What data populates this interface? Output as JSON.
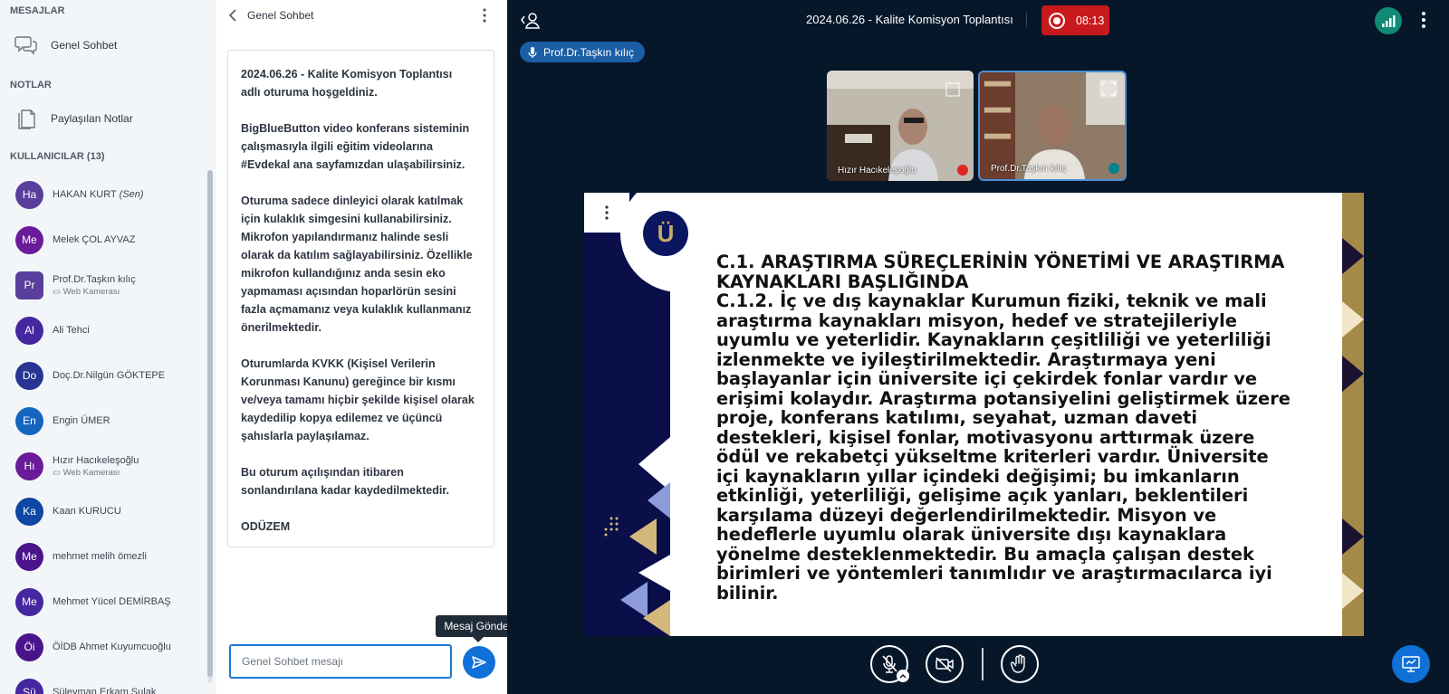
{
  "sidebar": {
    "messages_title": "MESAJLAR",
    "public_chat_label": "Genel Sohbet",
    "notes_title": "NOTLAR",
    "shared_notes_label": "Paylaşılan Notlar",
    "users_title": "KULLANICILAR (13)",
    "users": [
      {
        "initials": "Ha",
        "name": "HAKAN KURT",
        "suffix": "(Sen)",
        "sub": "",
        "color": "#5a3e9c",
        "status": "muted"
      },
      {
        "initials": "Me",
        "name": "Melek ÇOL AYVAZ",
        "suffix": "",
        "sub": "",
        "color": "#6a1b9a",
        "status": "muted"
      },
      {
        "initials": "Pr",
        "name": "Prof.Dr.Taşkın kılıç",
        "suffix": "",
        "sub": "Web Kamerası",
        "color": "#5a3e9c",
        "status": "mic"
      },
      {
        "initials": "Al",
        "name": "Ali Tehci",
        "suffix": "",
        "sub": "",
        "color": "#4527a0",
        "status": "listen"
      },
      {
        "initials": "Do",
        "name": "Doç.Dr.Nilgün GÖKTEPE",
        "suffix": "",
        "sub": "",
        "color": "#283593",
        "status": "muted"
      },
      {
        "initials": "En",
        "name": "Engin ÜMER",
        "suffix": "",
        "sub": "",
        "color": "#1565c0",
        "status": "muted"
      },
      {
        "initials": "Hı",
        "name": "Hızır Hacıkeleşoğlu",
        "suffix": "",
        "sub": "Web Kamerası",
        "color": "#6a1b9a",
        "status": "muted"
      },
      {
        "initials": "Ka",
        "name": "Kaan KURUCU",
        "suffix": "",
        "sub": "",
        "color": "#0d47a1",
        "status": "listen"
      },
      {
        "initials": "Me",
        "name": "mehmet melih ömezli",
        "suffix": "",
        "sub": "",
        "color": "#4a148c",
        "status": "muted"
      },
      {
        "initials": "Me",
        "name": "Mehmet Yücel DEMİRBAŞ",
        "suffix": "",
        "sub": "",
        "color": "#4527a0",
        "status": "listen"
      },
      {
        "initials": "Öi",
        "name": "ÖİDB Ahmet Kuyumcuoğlu",
        "suffix": "",
        "sub": "",
        "color": "#4a148c",
        "status": "muted"
      },
      {
        "initials": "Sü",
        "name": "Süleyman Erkam Sulak",
        "suffix": "",
        "sub": "",
        "color": "#4527a0",
        "status": "muted"
      }
    ]
  },
  "chat": {
    "title": "Genel Sohbet",
    "welcome_title": "2024.06.26 - Kalite Komisyon Toplantısı",
    "welcome_p1_rest": "adlı oturuma hoşgeldiniz.",
    "welcome_p2": "BigBlueButton video konferans sisteminin\nçalışmasıyla ilgili eğitim videolarına\n#Evdekal ana sayfamızdan ulaşabilirsiniz.",
    "welcome_p3": "Oturuma sadece dinleyici olarak katılmak\niçin kulaklık simgesini kullanabilirsiniz.\nMikrofon yapılandırmanız halinde sesli\nolarak da katılım sağlayabilirsiniz. Özellikle\nmikrofon kullandığınız anda sesin eko\nyapmaması açısından hoparlörün sesini\nfazla açmamanız veya kulaklık kullanmanız\nönerilmektedir.",
    "welcome_p4": "Oturumlarda KVKK (Kişisel Verilerin\nKorunması Kanunu) gereğince bir kısmı\nve/veya tamamı hiçbir şekilde kişisel olarak\nkaydedilip kopya edilemez ve üçüncü\nşahıslarla paylaşılamaz.",
    "welcome_p5": "Bu oturum açılışından itibaren\nsonlandırılana kadar kaydedilmektedir.",
    "welcome_sign": "ODÜZEM",
    "input_placeholder": "Genel Sohbet mesajı",
    "send_tooltip": "Mesaj Gönder"
  },
  "main": {
    "meeting_title": "2024.06.26 - Kalite Komisyon Toplantısı",
    "recording_time": "08:13",
    "talking_user": "Prof.Dr.Taşkın kılıç",
    "cams": [
      {
        "name": "Hızır Hacıkeleşoğlu",
        "status": "muted"
      },
      {
        "name": "Prof.Dr.Taşkın kılıç",
        "status": "mic"
      }
    ],
    "slide": {
      "logo_letter": "Ü",
      "lines": [
        "C.1. ARAŞTIRMA SÜREÇLERİNİN YÖNETİMİ VE ARAŞTIRMA",
        "KAYNAKLARI BAŞLIĞINDA",
        "C.1.2. İç ve dış kaynaklar  Kurumun fiziki, teknik ve mali",
        "araştırma kaynakları misyon, hedef ve stratejileriyle",
        "uyumlu ve yeterlidir. Kaynakların çeşitliliği ve yeterliliği",
        "izlenmekte ve iyileştirilmektedir.  Araştırmaya yeni",
        "başlayanlar için üniversite içi çekirdek fonlar vardır ve",
        "erişimi kolaydır. Araştırma potansiyelini geliştirmek üzere",
        "proje, konferans katılımı, seyahat, uzman daveti",
        "destekleri, kişisel fonlar, motivasyonu arttırmak üzere",
        "ödül ve rekabetçi yükseltme kriterleri vardır. Üniversite",
        "içi kaynakların yıllar içindeki değişimi; bu imkanların",
        "etkinliği, yeterliliği, gelişime açık yanları, beklentileri",
        "karşılama düzeyi değerlendirilmektedir.  Misyon ve",
        "hedeflerle uyumlu olarak üniversite dışı kaynaklara",
        "yönelme desteklenmektedir. Bu amaçla çalışan destek",
        "birimleri ve yöntemleri tanımlıdır ve araştırmacılarca iyi",
        "bilinir."
      ]
    },
    "colors": {
      "background": "#06172a",
      "accent": "#0f70d7",
      "recording": "#c8191d",
      "muted": "#df2721",
      "connection": "#0f8a75"
    }
  }
}
